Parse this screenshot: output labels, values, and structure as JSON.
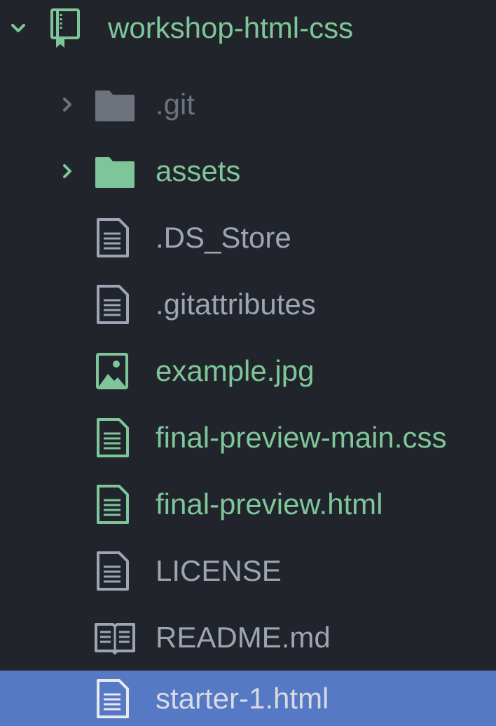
{
  "tree": {
    "root": {
      "label": "workshop-html-css",
      "icon": "repo-book-icon",
      "expanded": true,
      "status": "added"
    },
    "items": [
      {
        "label": ".git",
        "kind": "folder",
        "icon": "folder-icon",
        "expanded": false,
        "status": "ignored"
      },
      {
        "label": "assets",
        "kind": "folder",
        "icon": "folder-icon",
        "expanded": false,
        "status": "added"
      },
      {
        "label": ".DS_Store",
        "kind": "file",
        "icon": "text-file-icon",
        "status": "none"
      },
      {
        "label": ".gitattributes",
        "kind": "file",
        "icon": "text-file-icon",
        "status": "none"
      },
      {
        "label": "example.jpg",
        "kind": "file",
        "icon": "image-file-icon",
        "status": "added"
      },
      {
        "label": "final-preview-main.css",
        "kind": "file",
        "icon": "text-file-icon",
        "status": "added"
      },
      {
        "label": "final-preview.html",
        "kind": "file",
        "icon": "text-file-icon",
        "status": "added"
      },
      {
        "label": "LICENSE",
        "kind": "file",
        "icon": "text-file-icon",
        "status": "none"
      },
      {
        "label": "README.md",
        "kind": "file",
        "icon": "book-icon",
        "status": "none"
      },
      {
        "label": "starter-1.html",
        "kind": "file",
        "icon": "text-file-icon",
        "status": "none",
        "selected": true
      }
    ]
  },
  "colors": {
    "background": "#21252b",
    "selection": "#5579c5",
    "added": "#7ec699",
    "ignored": "#6d737c",
    "default_text": "#9da5b4",
    "selected_text": "#d7dae0"
  }
}
